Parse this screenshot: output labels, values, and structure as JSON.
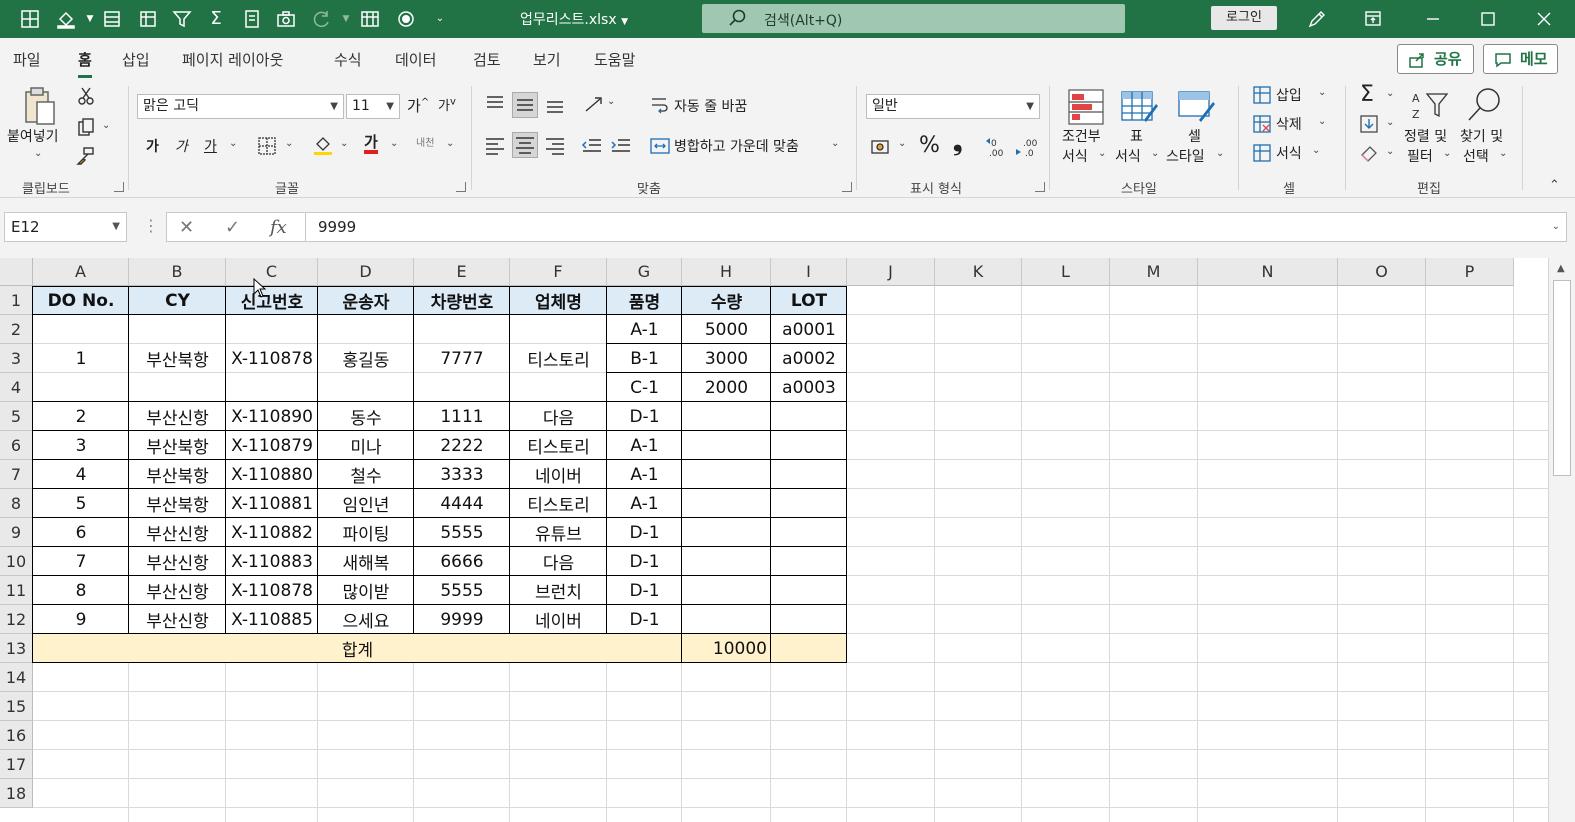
{
  "titlebar": {
    "filename": "업무리스트.xlsx",
    "search_placeholder": "검색(Alt+Q)",
    "login": "로그인",
    "bg_color": "#217346"
  },
  "menu": {
    "tabs": [
      "파일",
      "홈",
      "삽입",
      "페이지 레이아웃",
      "수식",
      "데이터",
      "검토",
      "보기",
      "도움말"
    ],
    "active": "홈",
    "share": "공유",
    "memo": "메모"
  },
  "ribbon": {
    "clipboard": {
      "paste": "붙여넣기",
      "label": "클립보드"
    },
    "font": {
      "name": "맑은 고딕",
      "size": "11",
      "bold": "가",
      "italic": "가",
      "underline": "가",
      "phonetic": "내천",
      "label": "글꼴"
    },
    "align": {
      "wrap": "자동 줄 바꿈",
      "merge": "병합하고 가운데 맞춤",
      "label": "맞춤"
    },
    "number": {
      "format": "일반",
      "percent": "%",
      "comma": "❟",
      "label": "표시 형식"
    },
    "styles": {
      "conditional_1": "조건부",
      "conditional_2": "서식",
      "table_1": "표",
      "table_2": "서식",
      "cell_1": "셀",
      "cell_2": "스타일",
      "label": "스타일"
    },
    "cells": {
      "insert": "삽입",
      "delete": "삭제",
      "format": "서식",
      "label": "셀"
    },
    "editing": {
      "sort_1": "정렬 및",
      "sort_2": "필터",
      "find_1": "찾기 및",
      "find_2": "선택",
      "label": "편집"
    }
  },
  "formula_bar": {
    "name_box": "E12",
    "fx": "fx",
    "value": "9999"
  },
  "sheet": {
    "columns": [
      "A",
      "B",
      "C",
      "D",
      "E",
      "F",
      "G",
      "H",
      "I",
      "J",
      "K",
      "L",
      "M",
      "N",
      "O",
      "P"
    ],
    "rows": [
      "1",
      "2",
      "3",
      "4",
      "5",
      "6",
      "7",
      "8",
      "9",
      "10",
      "11",
      "12",
      "13",
      "14",
      "15",
      "16",
      "17",
      "18"
    ],
    "header": [
      "DO No.",
      "CY",
      "신고번호",
      "운송자",
      "차량번호",
      "업체명",
      "품명",
      "수량",
      "LOT"
    ],
    "merged_first": {
      "do_no": "1",
      "cy": "부산북항",
      "report_no": "X-110878",
      "carrier": "홍길동",
      "vehicle": "7777",
      "company": "티스토리"
    },
    "sub_rows": [
      {
        "item": "A-1",
        "qty": "5000",
        "lot": "a0001"
      },
      {
        "item": "B-1",
        "qty": "3000",
        "lot": "a0002"
      },
      {
        "item": "C-1",
        "qty": "2000",
        "lot": "a0003"
      }
    ],
    "data_rows": [
      [
        "2",
        "부산신항",
        "X-110890",
        "동수",
        "1111",
        "다음",
        "D-1"
      ],
      [
        "3",
        "부산북항",
        "X-110879",
        "미나",
        "2222",
        "티스토리",
        "A-1"
      ],
      [
        "4",
        "부산북항",
        "X-110880",
        "철수",
        "3333",
        "네이버",
        "A-1"
      ],
      [
        "5",
        "부산북항",
        "X-110881",
        "임인년",
        "4444",
        "티스토리",
        "A-1"
      ],
      [
        "6",
        "부산신항",
        "X-110882",
        "파이팅",
        "5555",
        "유튜브",
        "D-1"
      ],
      [
        "7",
        "부산신항",
        "X-110883",
        "새해복",
        "6666",
        "다음",
        "D-1"
      ],
      [
        "8",
        "부산신항",
        "X-110878",
        "많이받",
        "5555",
        "브런치",
        "D-1"
      ],
      [
        "9",
        "부산신항",
        "X-110885",
        "으세요",
        "9999",
        "네이버",
        "D-1"
      ]
    ],
    "total": {
      "label": "합계",
      "qty": "10000"
    },
    "header_fill": "#ddebf7",
    "total_fill": "#fff2cc"
  }
}
